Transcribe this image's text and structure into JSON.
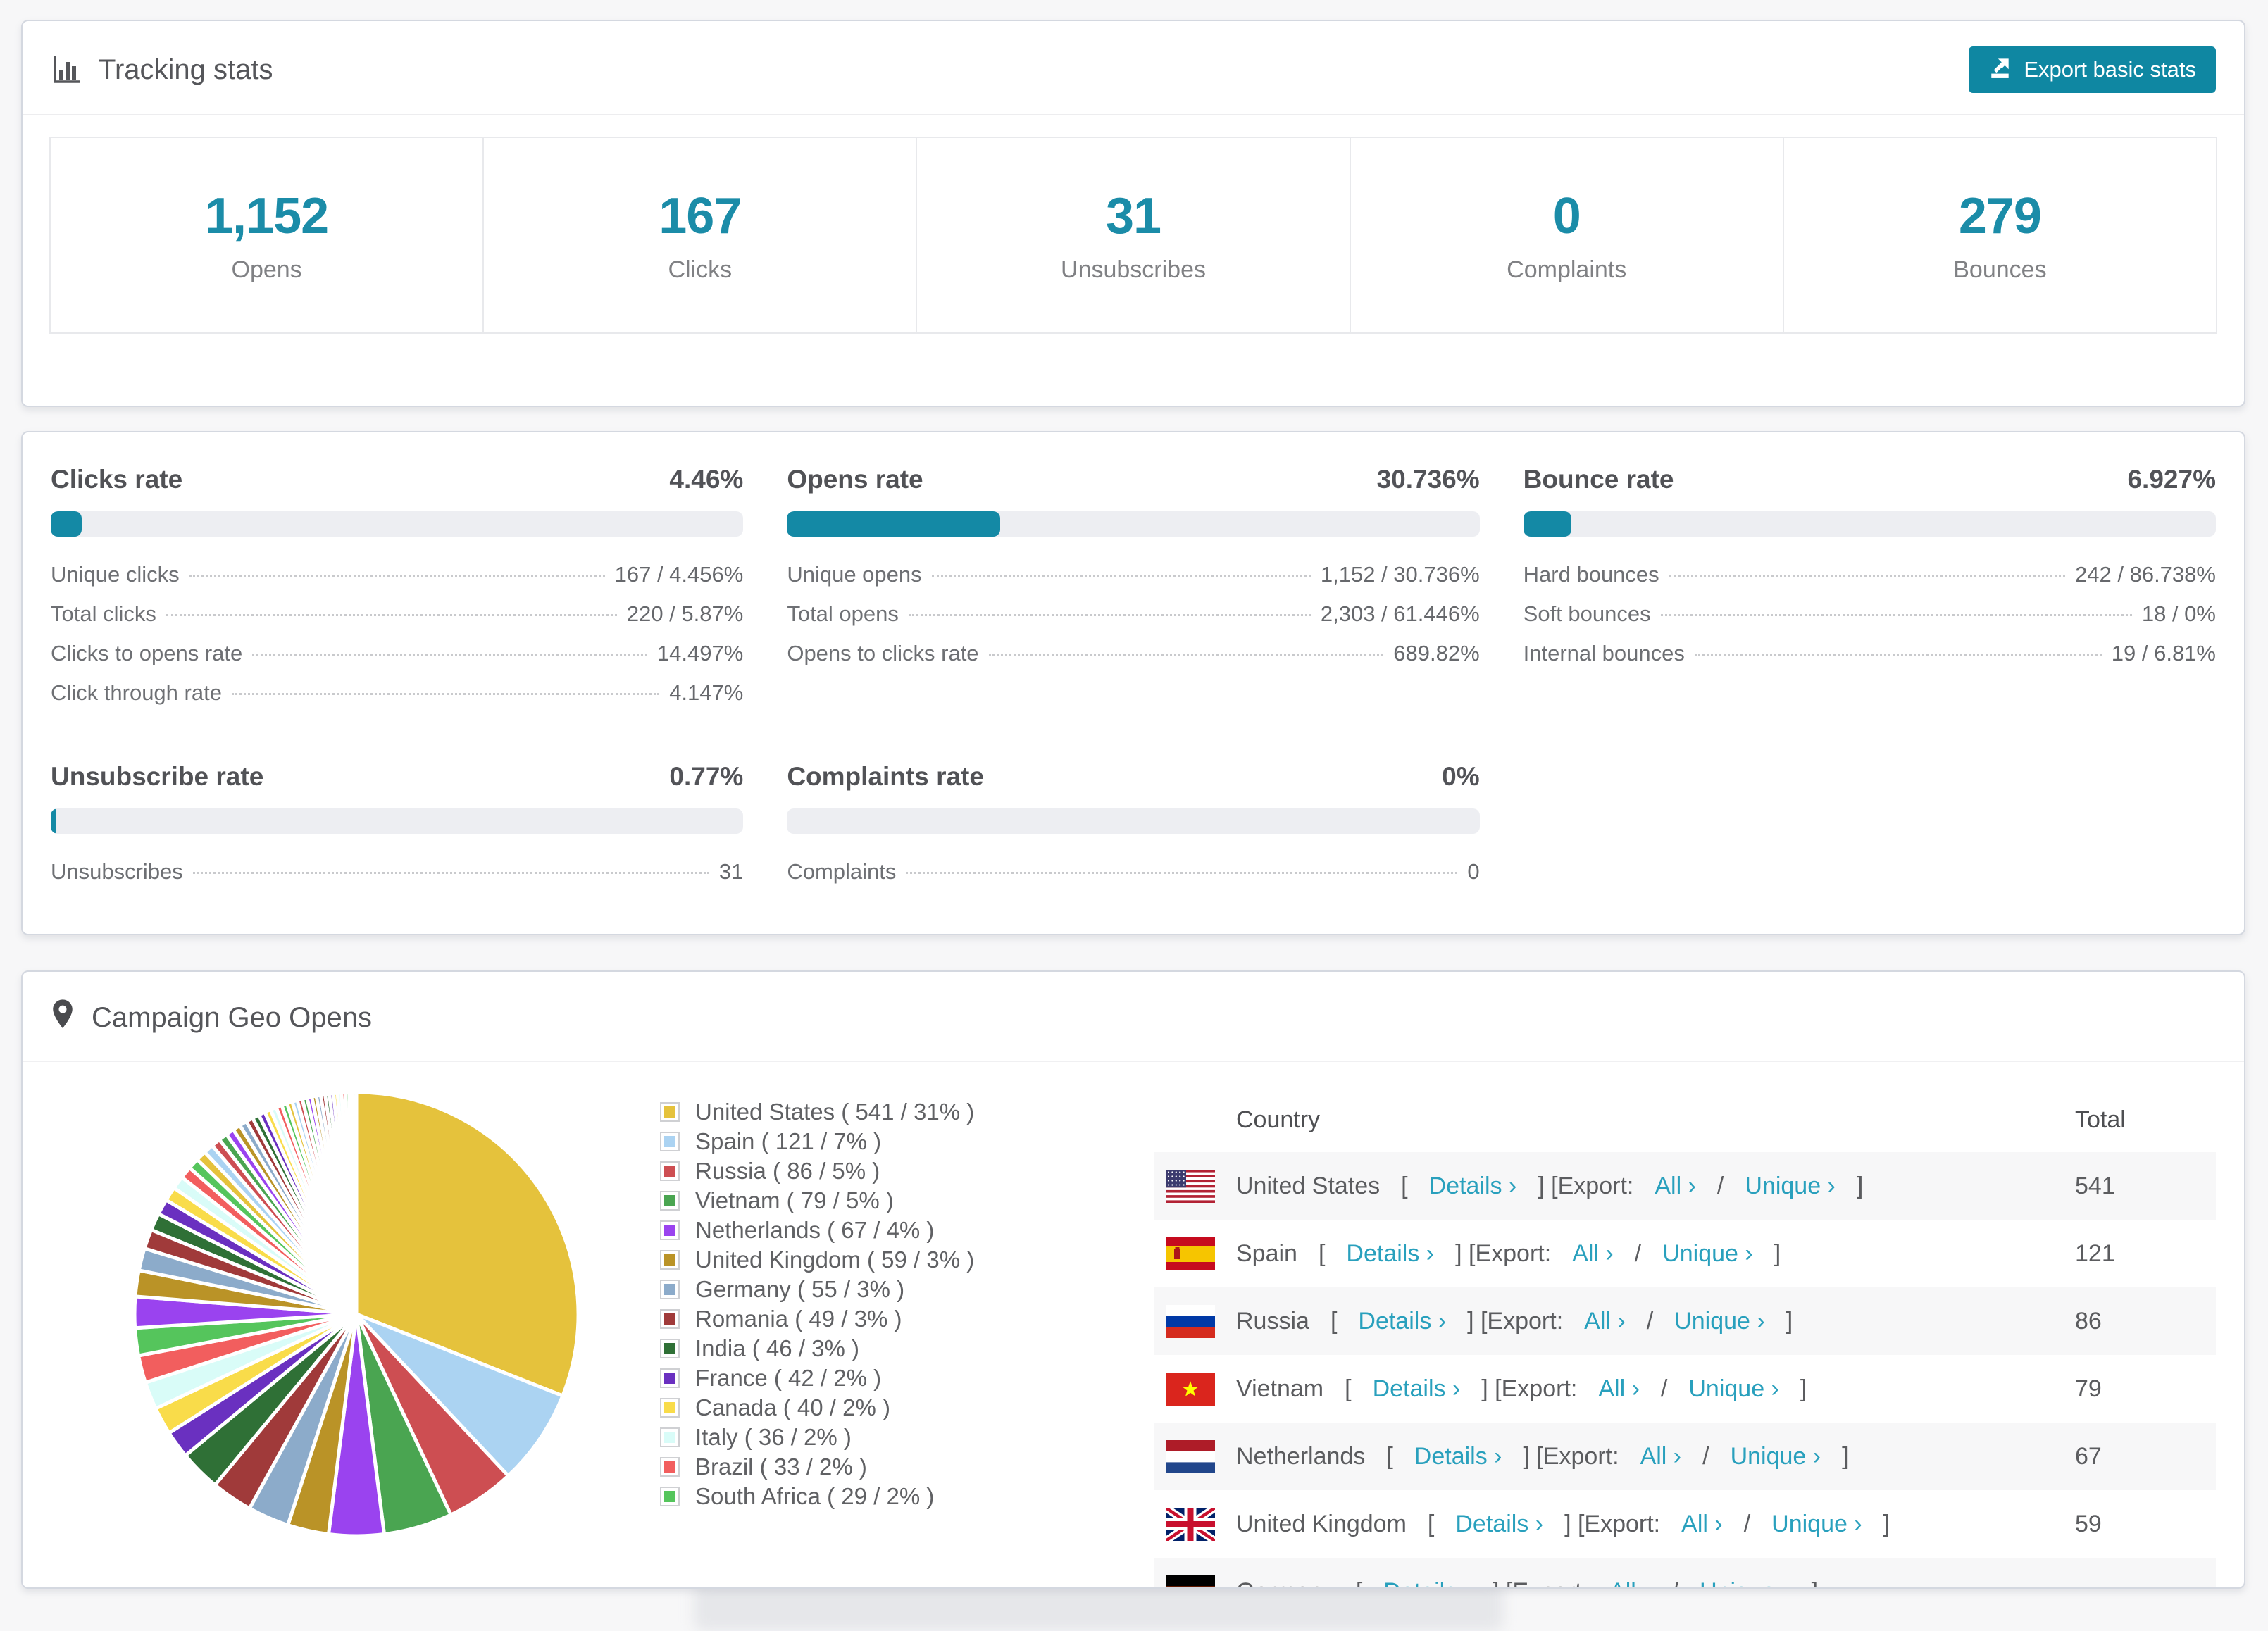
{
  "theme": {
    "accent_teal": "#1489a5",
    "number_teal": "#1b8ca8",
    "link_teal": "#29a0bd",
    "bar_track": "#edeef2",
    "stripe": "#f7f7f8"
  },
  "tracking": {
    "title": "Tracking stats",
    "export_label": "Export basic stats",
    "stats": [
      {
        "value": "1,152",
        "label": "Opens"
      },
      {
        "value": "167",
        "label": "Clicks"
      },
      {
        "value": "31",
        "label": "Unsubscribes"
      },
      {
        "value": "0",
        "label": "Complaints"
      },
      {
        "value": "279",
        "label": "Bounces"
      }
    ]
  },
  "rates": {
    "blocks": [
      {
        "title": "Clicks rate",
        "value": "4.46%",
        "percent": 4.46,
        "rows": [
          {
            "label": "Unique clicks",
            "value": "167 / 4.456%"
          },
          {
            "label": "Total clicks",
            "value": "220 / 5.87%"
          },
          {
            "label": "Clicks to opens rate",
            "value": "14.497%"
          },
          {
            "label": "Click through rate",
            "value": "4.147%"
          }
        ]
      },
      {
        "title": "Opens rate",
        "value": "30.736%",
        "percent": 30.736,
        "rows": [
          {
            "label": "Unique opens",
            "value": "1,152 / 30.736%"
          },
          {
            "label": "Total opens",
            "value": "2,303 / 61.446%"
          },
          {
            "label": "Opens to clicks rate",
            "value": "689.82%"
          }
        ]
      },
      {
        "title": "Bounce rate",
        "value": "6.927%",
        "percent": 6.927,
        "rows": [
          {
            "label": "Hard bounces",
            "value": "242 / 86.738%"
          },
          {
            "label": "Soft bounces",
            "value": "18 / 0%"
          },
          {
            "label": "Internal bounces",
            "value": "19 / 6.81%"
          }
        ]
      },
      {
        "title": "Unsubscribe rate",
        "value": "0.77%",
        "percent": 0.77,
        "rows": [
          {
            "label": "Unsubscribes",
            "value": "31"
          }
        ]
      },
      {
        "title": "Complaints rate",
        "value": "0%",
        "percent": 0,
        "rows": [
          {
            "label": "Complaints",
            "value": "0"
          }
        ]
      }
    ]
  },
  "geo": {
    "title": "Campaign Geo Opens",
    "table": {
      "country_header": "Country",
      "total_header": "Total",
      "details_label": "Details ›",
      "export_prefix": "] [Export: ",
      "all_label": "All ›",
      "separator": " / ",
      "unique_label": "Unique ›",
      "open_bracket": "[",
      "close_bracket": "]",
      "rows": [
        {
          "country": "United States",
          "flag": "us",
          "total": "541"
        },
        {
          "country": "Spain",
          "flag": "es",
          "total": "121"
        },
        {
          "country": "Russia",
          "flag": "ru",
          "total": "86"
        },
        {
          "country": "Vietnam",
          "flag": "vn",
          "total": "79"
        },
        {
          "country": "Netherlands",
          "flag": "nl",
          "total": "67"
        },
        {
          "country": "United Kingdom",
          "flag": "gb",
          "total": "59"
        },
        {
          "country": "Germany",
          "flag": "de",
          "total": ""
        }
      ]
    }
  },
  "chart_data": {
    "type": "pie",
    "title": "Campaign Geo Opens",
    "legend_position": "right",
    "start_angle_deg": -90,
    "direction": "clockwise",
    "slices": [
      {
        "label": "United States",
        "value": 541,
        "pct": 31,
        "color": "#e5c23c"
      },
      {
        "label": "Spain",
        "value": 121,
        "pct": 7,
        "color": "#abd3f2"
      },
      {
        "label": "Russia",
        "value": 86,
        "pct": 5,
        "color": "#cd4e52"
      },
      {
        "label": "Vietnam",
        "value": 79,
        "pct": 5,
        "color": "#4aa551"
      },
      {
        "label": "Netherlands",
        "value": 67,
        "pct": 4,
        "color": "#9a43ef"
      },
      {
        "label": "United Kingdom",
        "value": 59,
        "pct": 3,
        "color": "#ba9327"
      },
      {
        "label": "Germany",
        "value": 55,
        "pct": 3,
        "color": "#8cabca"
      },
      {
        "label": "Romania",
        "value": 49,
        "pct": 3,
        "color": "#a03a3a"
      },
      {
        "label": "India",
        "value": 46,
        "pct": 3,
        "color": "#2f7036"
      },
      {
        "label": "France",
        "value": 42,
        "pct": 2,
        "color": "#6a30c0"
      },
      {
        "label": "Canada",
        "value": 40,
        "pct": 2,
        "color": "#f9dc4a"
      },
      {
        "label": "Italy",
        "value": 36,
        "pct": 2,
        "color": "#d9fcf8"
      },
      {
        "label": "Brazil",
        "value": 33,
        "pct": 2,
        "color": "#f25e5e"
      },
      {
        "label": "South Africa",
        "value": 29,
        "pct": 2,
        "color": "#55c55c"
      }
    ],
    "others_pct": 26,
    "others_slice_count": 40
  }
}
